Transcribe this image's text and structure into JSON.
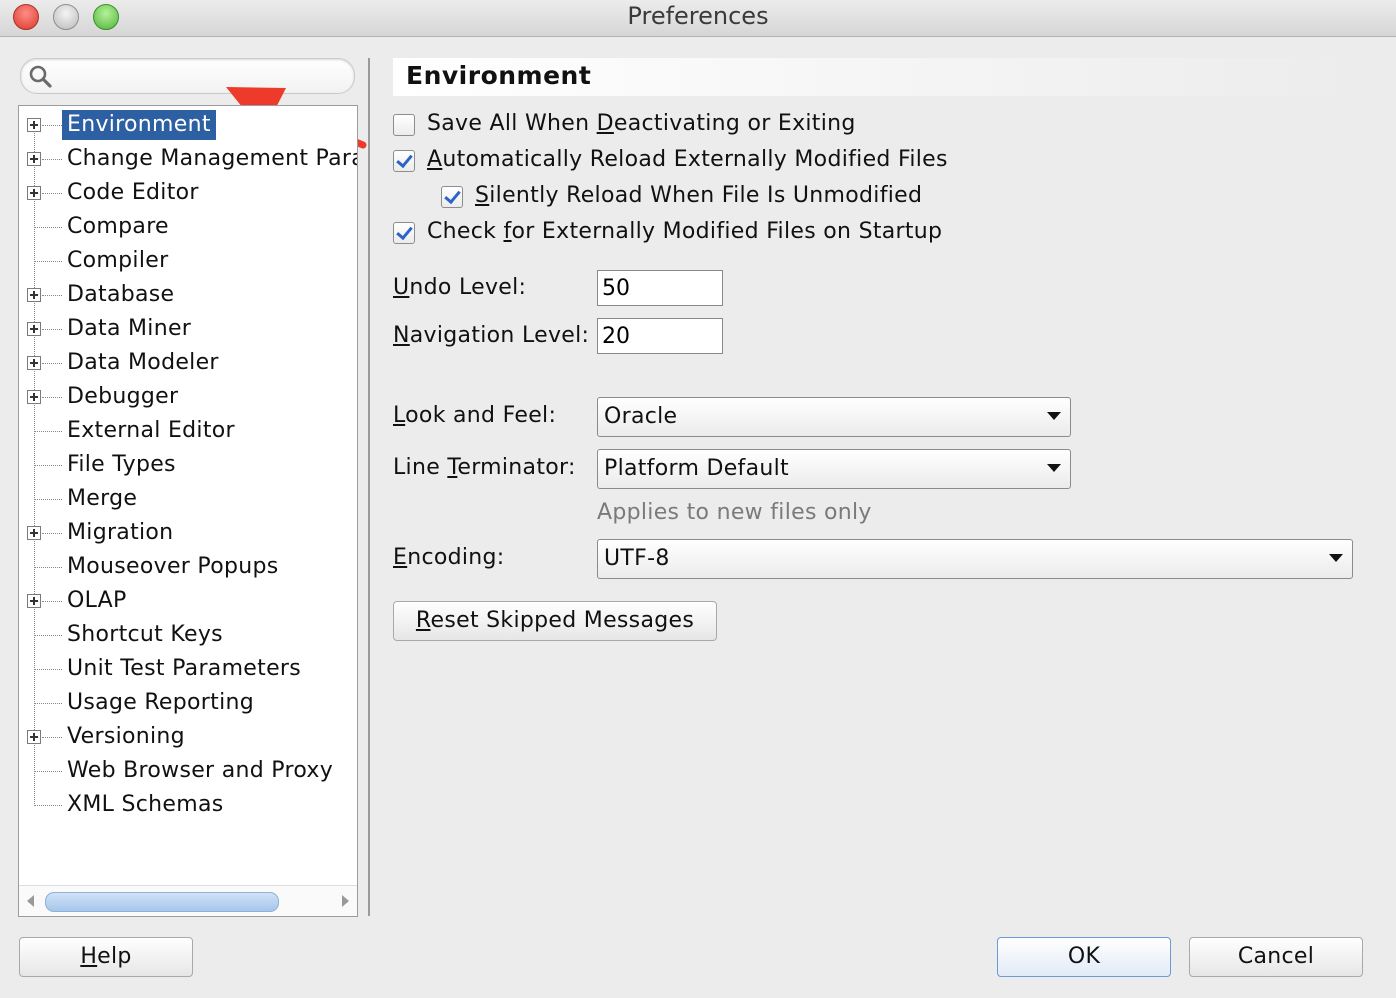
{
  "window": {
    "title": "Preferences"
  },
  "search": {
    "placeholder": "",
    "value": ""
  },
  "tree": {
    "items": [
      {
        "label": "Environment",
        "expandable": true,
        "selected": true
      },
      {
        "label": "Change Management Paran",
        "expandable": true
      },
      {
        "label": "Code Editor",
        "expandable": true
      },
      {
        "label": "Compare",
        "expandable": false
      },
      {
        "label": "Compiler",
        "expandable": false
      },
      {
        "label": "Database",
        "expandable": true
      },
      {
        "label": "Data Miner",
        "expandable": true
      },
      {
        "label": "Data Modeler",
        "expandable": true
      },
      {
        "label": "Debugger",
        "expandable": true
      },
      {
        "label": "External Editor",
        "expandable": false
      },
      {
        "label": "File Types",
        "expandable": false
      },
      {
        "label": "Merge",
        "expandable": false
      },
      {
        "label": "Migration",
        "expandable": true
      },
      {
        "label": "Mouseover Popups",
        "expandable": false
      },
      {
        "label": "OLAP",
        "expandable": true
      },
      {
        "label": "Shortcut Keys",
        "expandable": false
      },
      {
        "label": "Unit Test Parameters",
        "expandable": false
      },
      {
        "label": "Usage Reporting",
        "expandable": false
      },
      {
        "label": "Versioning",
        "expandable": true
      },
      {
        "label": "Web Browser and Proxy",
        "expandable": false
      },
      {
        "label": "XML Schemas",
        "expandable": false
      }
    ]
  },
  "panel": {
    "title": "Environment",
    "checkboxes": [
      {
        "pre": "Save All When ",
        "mn": "D",
        "post": "eactivating or Exiting",
        "checked": false
      },
      {
        "pre": "",
        "mn": "A",
        "post": "utomatically Reload Externally Modified Files",
        "checked": true
      },
      {
        "pre": "",
        "mn": "S",
        "post": "ilently Reload When File Is Unmodified",
        "checked": true
      },
      {
        "pre": "Check ",
        "mn": "f",
        "post": "or Externally Modified Files on Startup",
        "checked": true
      }
    ],
    "undo": {
      "pre": "",
      "mn": "U",
      "post": "ndo Level:",
      "value": "50"
    },
    "navigation": {
      "pre": "",
      "mn": "N",
      "post": "avigation Level:",
      "value": "20"
    },
    "look_and_feel": {
      "pre": "",
      "mn": "L",
      "post": "ook and Feel:",
      "value": "Oracle"
    },
    "line_terminator": {
      "pre": "Line ",
      "mn": "T",
      "post": "erminator:",
      "value": "Platform Default"
    },
    "terminator_hint": "Applies to new files only",
    "encoding": {
      "pre": "",
      "mn": "E",
      "post": "ncoding:",
      "value": "UTF-8"
    },
    "reset_button": {
      "pre": "",
      "mn": "R",
      "post": "eset Skipped Messages"
    }
  },
  "footer": {
    "help": {
      "pre": "",
      "mn": "H",
      "post": "elp"
    },
    "ok": "OK",
    "cancel": "Cancel"
  },
  "colors": {
    "selection": "#2d5fa3",
    "checkmark": "#2d63c8",
    "arrow": "#ee3a2a"
  }
}
